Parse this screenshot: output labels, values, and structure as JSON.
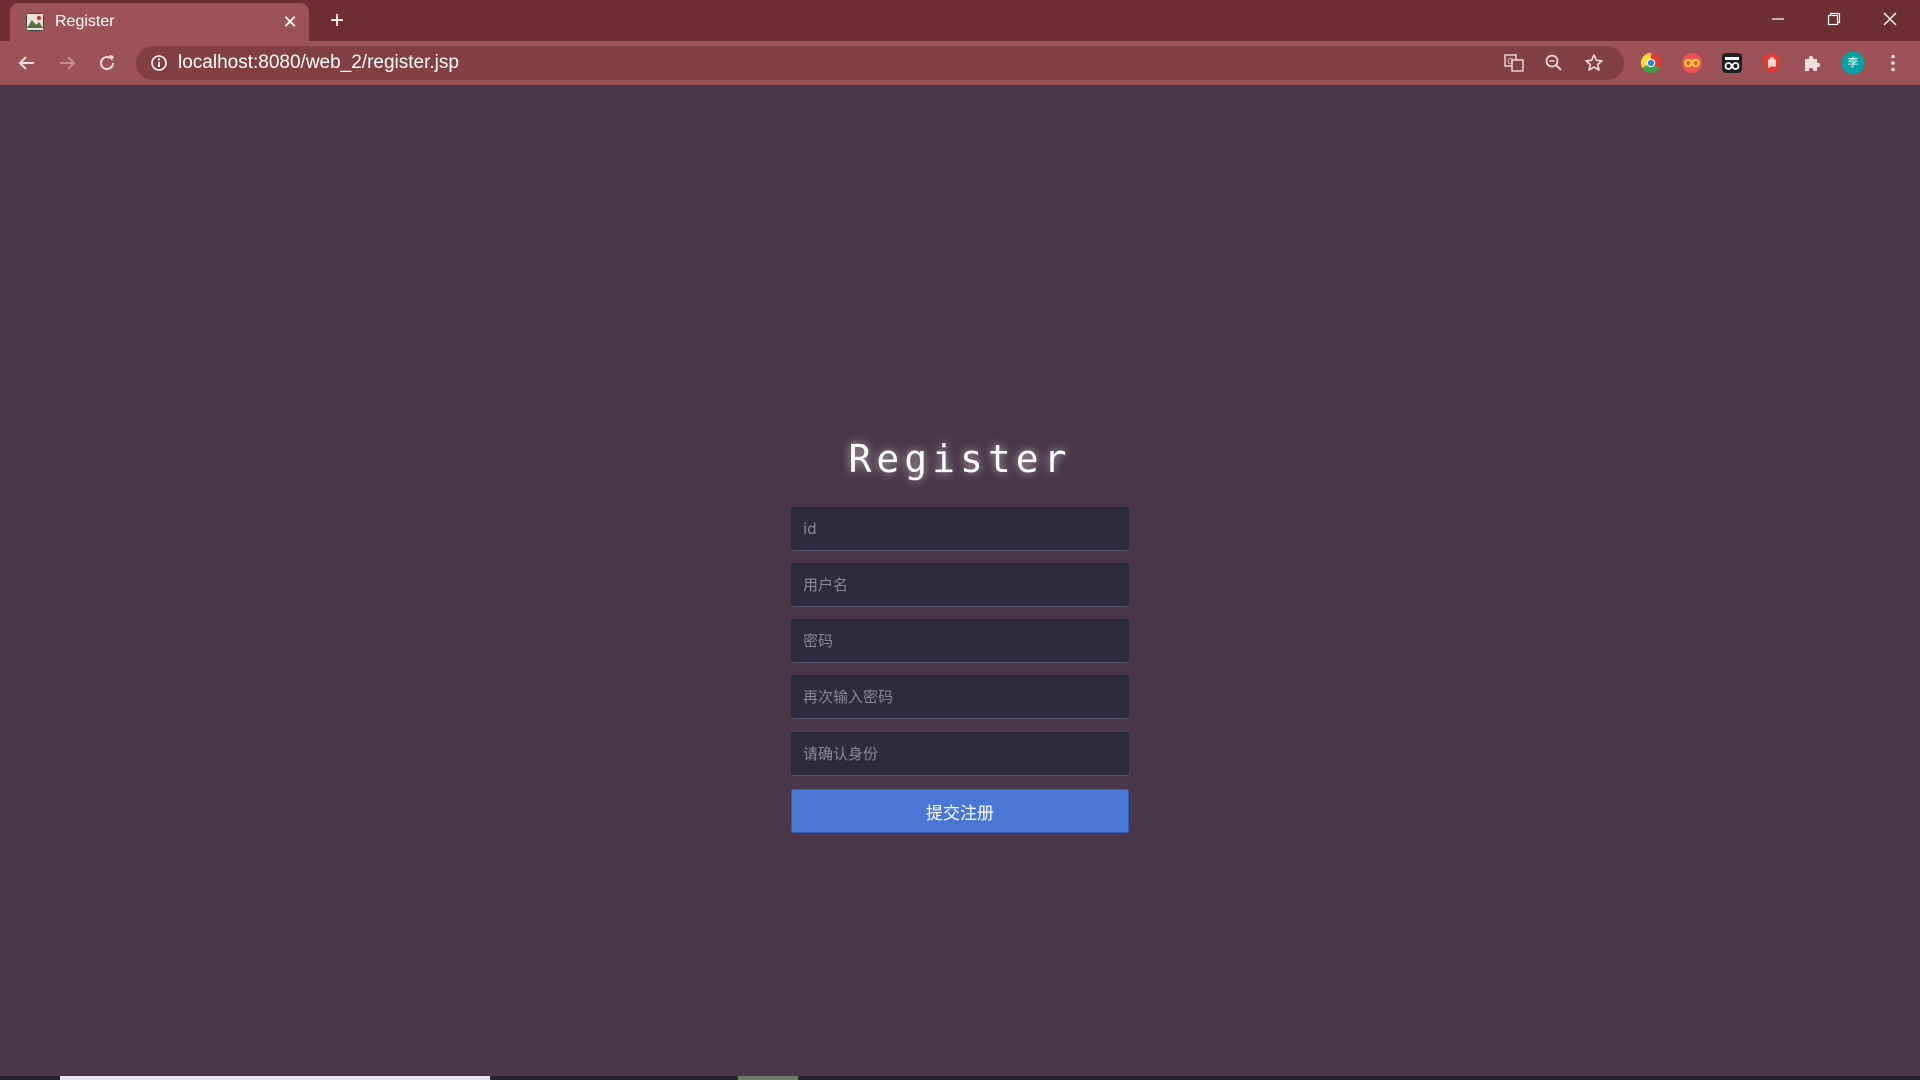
{
  "browser": {
    "tab": {
      "title": "Register",
      "favicon": "image-icon",
      "close_label": "✕"
    },
    "new_tab_label": "+",
    "window_controls": [
      "minimize-icon",
      "restore-icon",
      "close-icon"
    ],
    "address_bar": {
      "url": "localhost:8080/web_2/register.jsp"
    },
    "colors": {
      "tabstrip": "#6e2f33",
      "toolbar": "#9c5256",
      "omnibox": "#834043"
    },
    "extensions": [
      "chromium-icon",
      "glasses-icon",
      "spy-icon",
      "hand-icon",
      "puzzle-icon",
      "profile-avatar",
      "more-icon"
    ],
    "profile_initial": "李"
  },
  "page": {
    "title": "Register",
    "background": "#4a3749",
    "form": {
      "id_placeholder": "id",
      "username_placeholder": "用户名",
      "password_placeholder": "密码",
      "confirm_password_placeholder": "再次输入密码",
      "identity_placeholder": "请确认身份",
      "submit_label": "提交注册",
      "submit_color": "#4a77d4"
    }
  }
}
